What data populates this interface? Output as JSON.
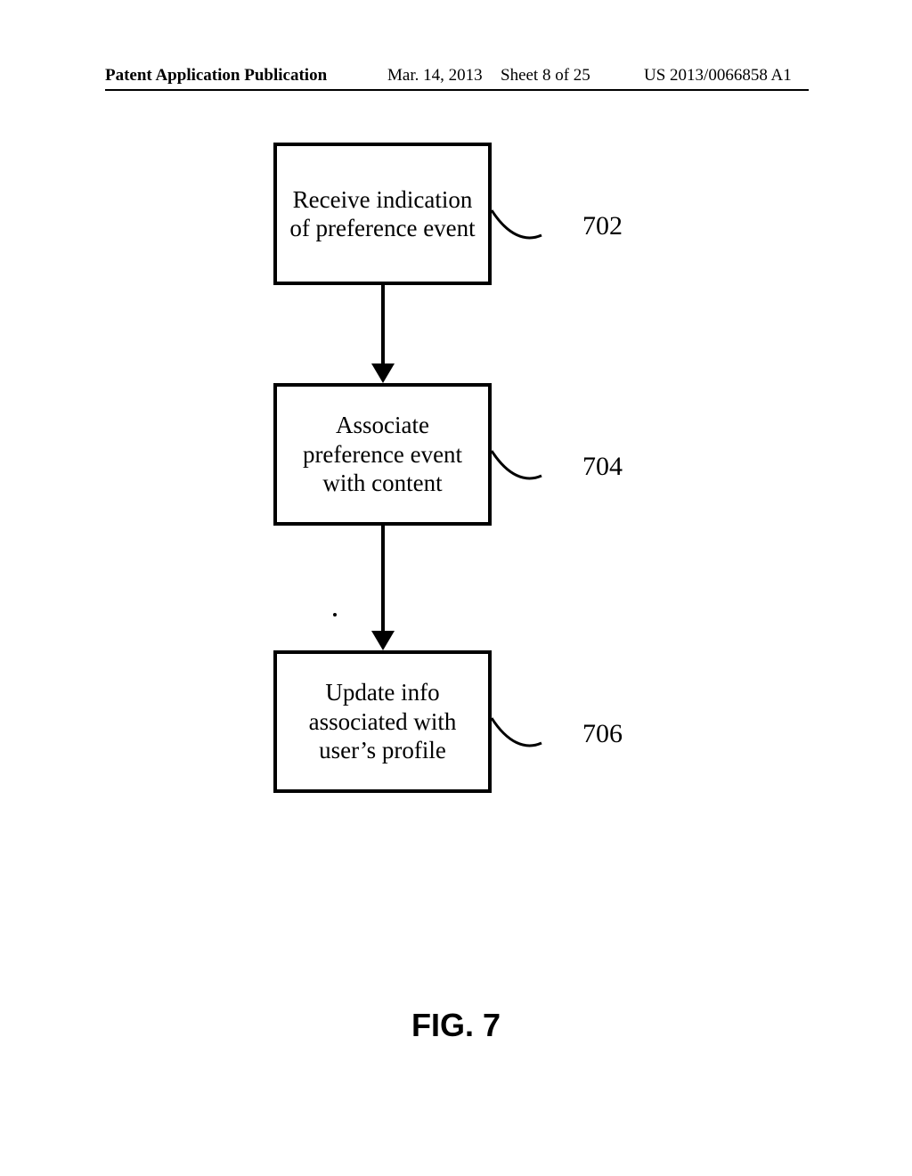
{
  "header": {
    "publication": "Patent Application Publication",
    "date": "Mar. 14, 2013",
    "sheet": "Sheet 8 of 25",
    "id": "US 2013/0066858 A1"
  },
  "flow": {
    "box1": {
      "text": "Receive indication of preference event",
      "ref": "702"
    },
    "box2": {
      "text": "Associate preference event with content",
      "ref": "704"
    },
    "box3": {
      "text": "Update info associated with user’s profile",
      "ref": "706"
    }
  },
  "figure_label": "FIG. 7"
}
